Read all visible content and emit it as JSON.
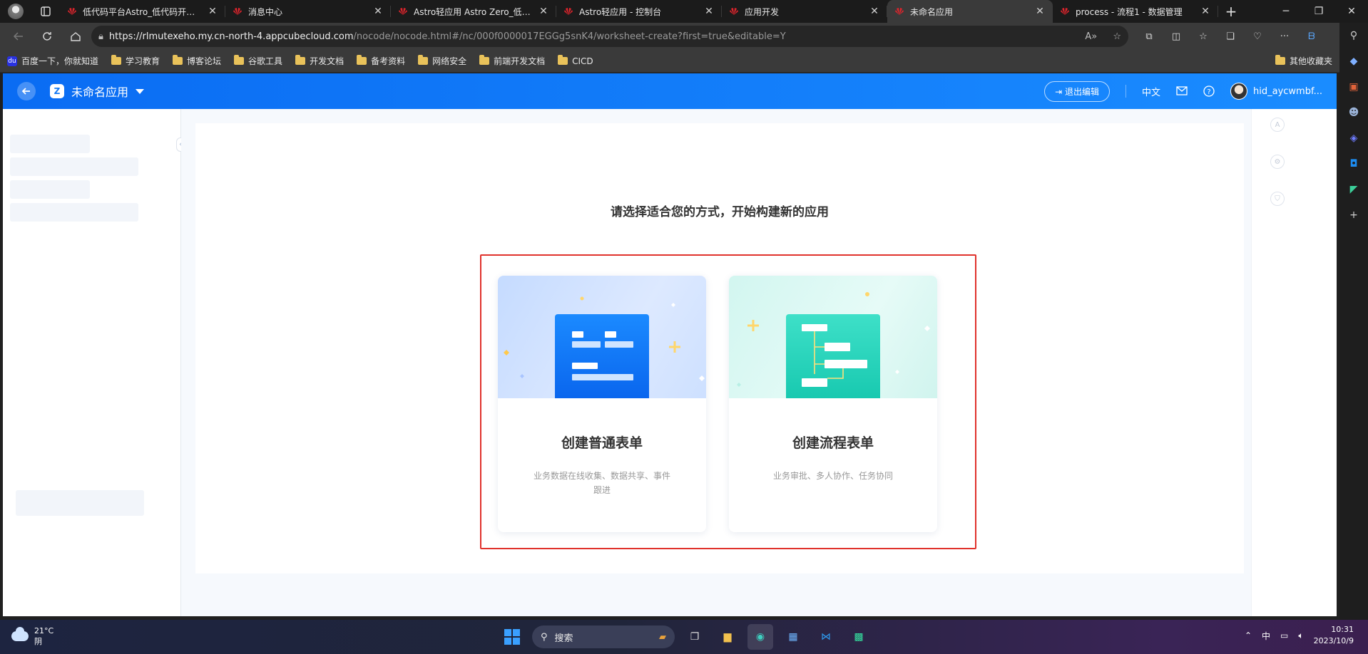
{
  "browser": {
    "tabs": [
      {
        "title": "低代码平台Astro_低代码开发平",
        "active": false
      },
      {
        "title": "消息中心",
        "active": false
      },
      {
        "title": "Astro轻应用 Astro Zero_低代码",
        "active": false
      },
      {
        "title": "Astro轻应用 - 控制台",
        "active": false
      },
      {
        "title": "应用开发",
        "active": false
      },
      {
        "title": "未命名应用",
        "active": true
      },
      {
        "title": "process - 流程1 - 数据管理",
        "active": false
      }
    ],
    "url_host": "https://rlmutexeho.my.cn-north-4.appcubecloud.com",
    "url_path": "/nocode/nocode.html#/nc/000f0000017EGGg5snK4/worksheet-create?first=true&editable=Y",
    "bookmarks": [
      "百度一下，你就知道",
      "学习教育",
      "博客论坛",
      "谷歌工具",
      "开发文档",
      "备考资料",
      "网络安全",
      "前端开发文档",
      "CICD"
    ],
    "bookmarks_other": "其他收藏夹"
  },
  "app": {
    "name": "未命名应用",
    "logo_glyph": "Z",
    "exit_edit": "退出编辑",
    "language": "中文",
    "username": "hid_aycwmbf...",
    "prompt": "请选择适合您的方式，开始构建新的应用",
    "cards": [
      {
        "title": "创建普通表单",
        "desc": "业务数据在线收集、数据共享、事件跟进"
      },
      {
        "title": "创建流程表单",
        "desc": "业务审批、多人协作、任务协同"
      }
    ],
    "colors": {
      "header": "#0a6cf3",
      "highlight": "#e0322c",
      "normal_card": "#1b8aff",
      "flow_card": "#2fd6bf"
    }
  },
  "taskbar": {
    "temperature": "21°C",
    "weather": "阴",
    "search_label": "搜索",
    "ime": "中",
    "time": "10:31",
    "date": "2023/10/9"
  }
}
